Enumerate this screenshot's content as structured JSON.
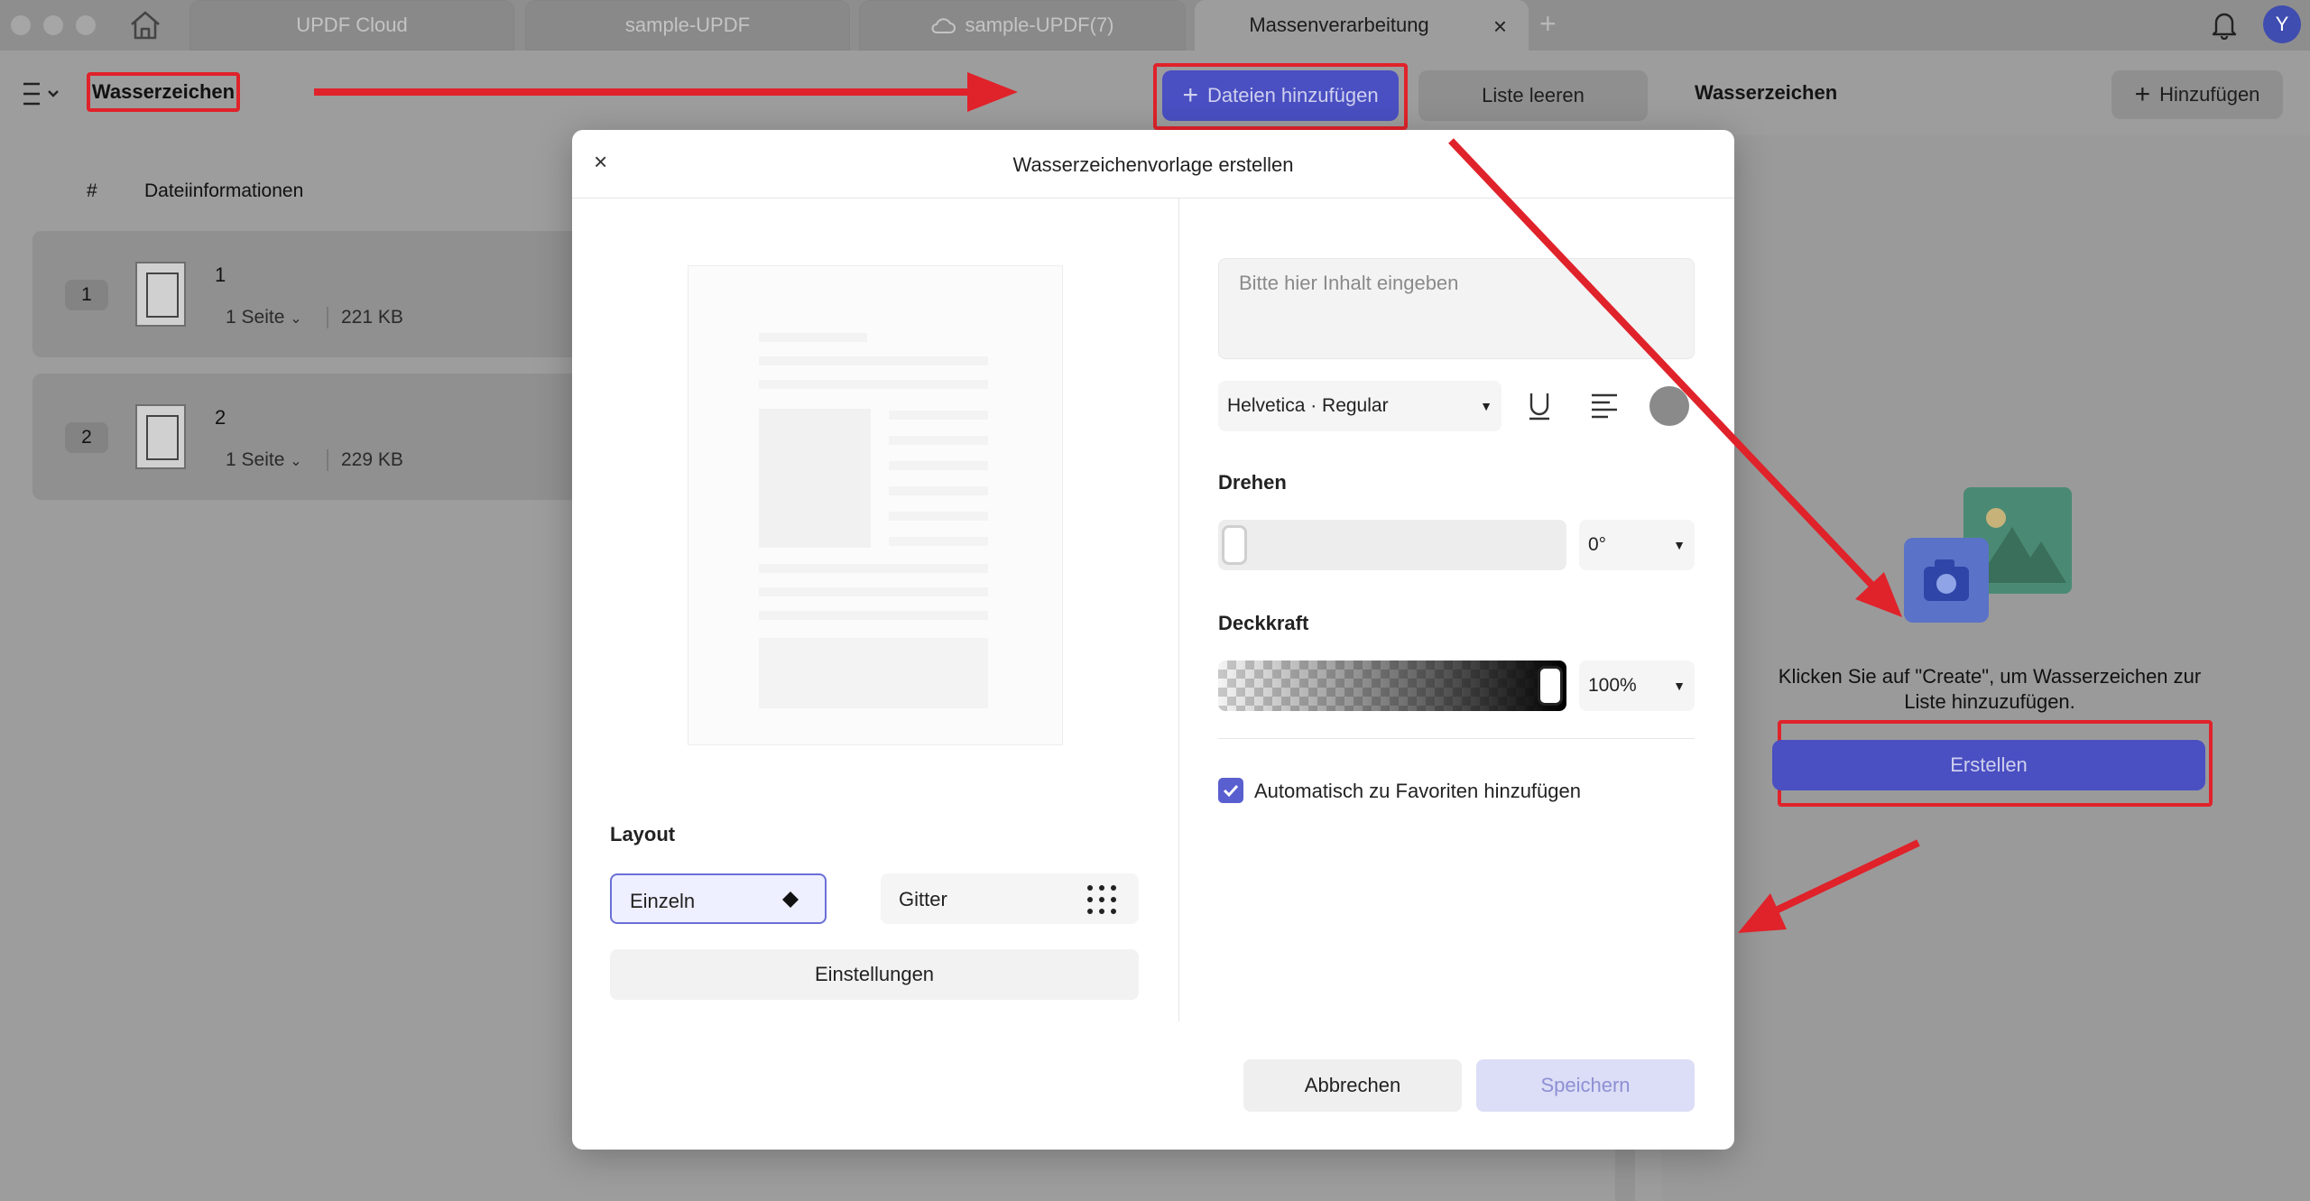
{
  "tabs": [
    {
      "label": "UPDF Cloud"
    },
    {
      "label": "sample-UPDF"
    },
    {
      "label": "sample-UPDF(7)"
    },
    {
      "label": "Massenverarbeitung"
    }
  ],
  "header": {
    "title": "Wasserzeichen",
    "add_files_label": "Dateien hinzufügen",
    "clear_list_label": "Liste leeren",
    "avatar_initial": "Y"
  },
  "file_list": {
    "col_number": "#",
    "col_info": "Dateiinformationen",
    "rows": [
      {
        "number": "1",
        "name": "1",
        "pages": "1 Seite",
        "size": "221 KB"
      },
      {
        "number": "2",
        "name": "2",
        "pages": "1 Seite",
        "size": "229 KB"
      }
    ]
  },
  "right_panel": {
    "title": "Wasserzeichen",
    "add_label": "Hinzufügen",
    "hint": "Klicken Sie auf \"Create\", um Wasserzeichen zur Liste hinzuzufügen.",
    "create_label": "Erstellen"
  },
  "modal": {
    "title": "Wasserzeichenvorlage erstellen",
    "content_placeholder": "Bitte hier Inhalt eingeben",
    "font": "Helvetica · Regular",
    "rotation_label": "Drehen",
    "rotation_value": "0°",
    "rotation_fraction": 0,
    "opacity_label": "Deckkraft",
    "opacity_value": "100%",
    "opacity_fraction": 1,
    "auto_favorite_label": "Automatisch zu Favoriten hinzufügen",
    "auto_favorite_checked": true,
    "layout_label": "Layout",
    "layout_options": [
      {
        "label": "Einzeln",
        "selected": true
      },
      {
        "label": "Gitter",
        "selected": false
      }
    ],
    "settings_label": "Einstellungen",
    "cancel_label": "Abbrechen",
    "save_label": "Speichern"
  },
  "colors": {
    "accent": "#4a4fc2",
    "annotation_red": "#e0222a",
    "watermark_color": "#8a8a8a"
  },
  "icons": [
    "home-icon",
    "cloud-icon",
    "bell-icon",
    "menu-icon",
    "plus-icon",
    "close-icon",
    "underline-icon",
    "align-icon",
    "diamond-icon",
    "grid-dots-icon",
    "camera-icon",
    "image-icon",
    "check-icon"
  ]
}
